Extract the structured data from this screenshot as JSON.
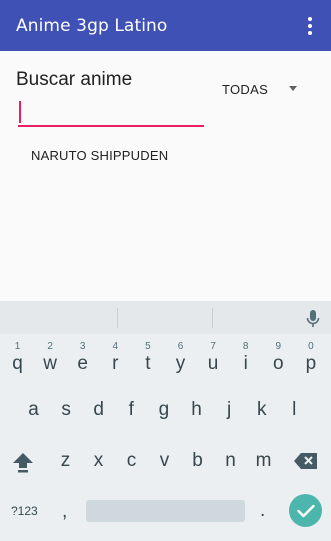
{
  "appbar": {
    "title": "Anime 3gp Latino",
    "menu_icon": "more-vert-icon",
    "color": "#3f51b5"
  },
  "search": {
    "label": "Buscar anime",
    "value": "",
    "accent": "#e91e63"
  },
  "filter": {
    "selected": "TODAS"
  },
  "results": [
    "NARUTO SHIPPUDEN"
  ],
  "keyboard": {
    "row1": [
      {
        "key": "q",
        "hint": "1"
      },
      {
        "key": "w",
        "hint": "2"
      },
      {
        "key": "e",
        "hint": "3"
      },
      {
        "key": "r",
        "hint": "4"
      },
      {
        "key": "t",
        "hint": "5"
      },
      {
        "key": "y",
        "hint": "6"
      },
      {
        "key": "u",
        "hint": "7"
      },
      {
        "key": "i",
        "hint": "8"
      },
      {
        "key": "o",
        "hint": "9"
      },
      {
        "key": "p",
        "hint": "0"
      }
    ],
    "row2": [
      "a",
      "s",
      "d",
      "f",
      "g",
      "h",
      "j",
      "k",
      "l"
    ],
    "row3": [
      "z",
      "x",
      "c",
      "v",
      "b",
      "n",
      "m"
    ],
    "symbols_label": "?123",
    "comma": ",",
    "period": ".",
    "enter_color": "#4db6ac"
  }
}
